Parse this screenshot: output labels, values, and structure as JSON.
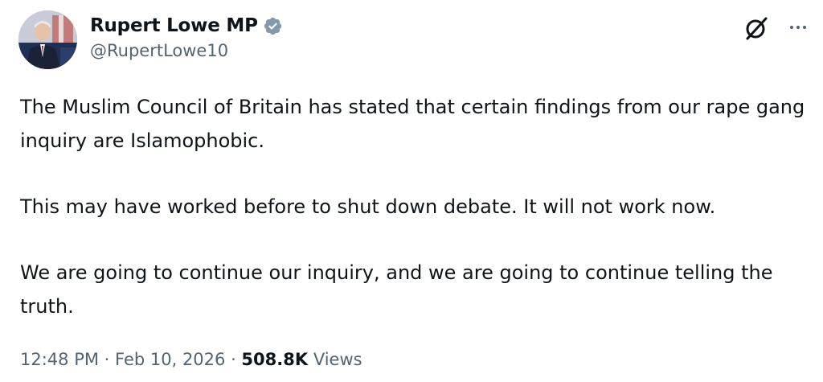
{
  "author": {
    "display_name": "Rupert Lowe MP",
    "handle": "@RupertLowe10",
    "verified_color": "#829aab"
  },
  "header": {
    "grok_icon": "grok-icon",
    "more_icon": "more-icon"
  },
  "tweet": {
    "paragraphs": [
      "The Muslim Council of Britain has stated that certain findings from our rape gang inquiry are Islamophobic.",
      "This may have worked before to shut down debate. It will not work now.",
      "We are going to continue our inquiry, and we are going to continue telling the truth."
    ]
  },
  "meta": {
    "time": "12:48 PM",
    "separator": " · ",
    "date": "Feb 10, 2026",
    "views_count": "508.8K",
    "views_label": "Views"
  }
}
